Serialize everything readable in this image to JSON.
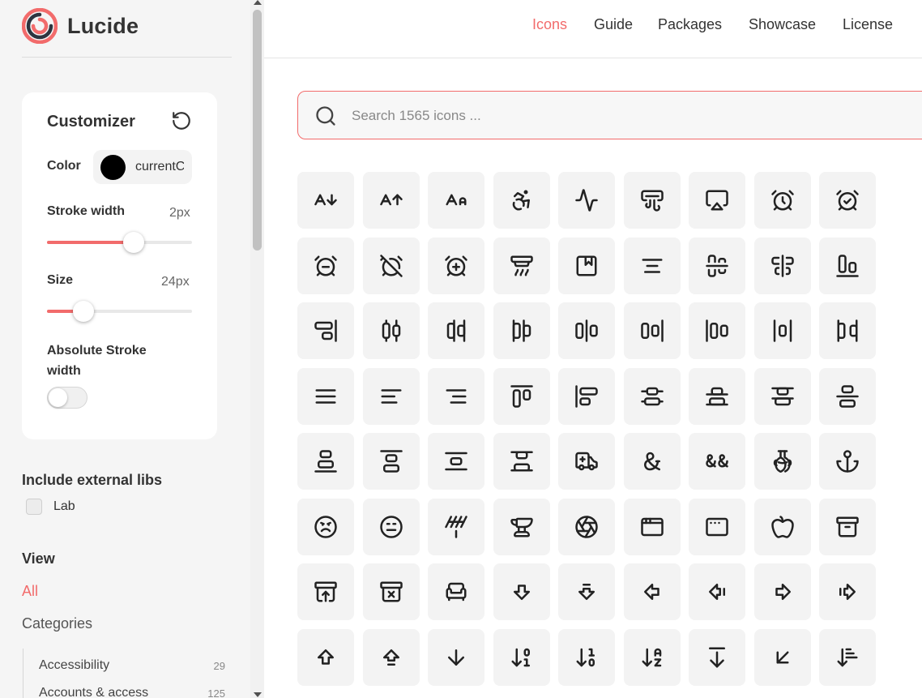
{
  "brand": {
    "name": "Lucide",
    "accent": "#f26b6b"
  },
  "nav": [
    {
      "label": "Icons",
      "active": true
    },
    {
      "label": "Guide",
      "active": false
    },
    {
      "label": "Packages",
      "active": false
    },
    {
      "label": "Showcase",
      "active": false
    },
    {
      "label": "License",
      "active": false
    }
  ],
  "customizer": {
    "title": "Customizer",
    "color_label": "Color",
    "color_value": "currentColor",
    "color_swatch": "#000000",
    "stroke_width_label": "Stroke width",
    "stroke_width_value": "2px",
    "stroke_width_fraction": 0.6,
    "size_label": "Size",
    "size_value": "24px",
    "size_fraction": 0.25,
    "absolute_stroke_label": "Absolute Stroke width",
    "absolute_stroke_on": false
  },
  "external_libs": {
    "title": "Include external libs",
    "items": [
      {
        "label": "Lab",
        "checked": false
      }
    ]
  },
  "view": {
    "title": "View",
    "all_label": "All",
    "categories_label": "Categories",
    "categories": [
      {
        "label": "Accessibility",
        "count": "29"
      },
      {
        "label": "Accounts & access",
        "count": "125"
      }
    ]
  },
  "search": {
    "placeholder": "Search 1565 icons ..."
  },
  "icons": [
    "a-arrow-down-icon",
    "a-arrow-up-icon",
    "a-large-small-icon",
    "accessibility-icon",
    "activity-icon",
    "air-vent-icon",
    "airplay-icon",
    "alarm-clock-icon",
    "alarm-clock-check-icon",
    "alarm-clock-minus-icon",
    "alarm-clock-off-icon",
    "alarm-clock-plus-icon",
    "alarm-smoke-icon",
    "album-icon",
    "align-center-icon",
    "align-center-horizontal-icon",
    "align-center-vertical-icon",
    "align-end-horizontal-icon",
    "align-end-vertical-icon",
    "align-horizontal-distribute-center-icon",
    "align-horizontal-distribute-end-icon",
    "align-horizontal-distribute-start-icon",
    "align-horizontal-justify-center-icon",
    "align-horizontal-justify-end-icon",
    "align-horizontal-justify-start-icon",
    "align-horizontal-space-around-icon",
    "align-horizontal-space-between-icon",
    "align-justify-icon",
    "align-left-icon",
    "align-right-icon",
    "align-start-horizontal-icon",
    "align-start-vertical-icon",
    "align-vertical-distribute-center-icon",
    "align-vertical-distribute-end-icon",
    "align-vertical-distribute-start-icon",
    "align-vertical-justify-center-icon",
    "align-vertical-justify-end-icon",
    "align-vertical-justify-start-icon",
    "align-vertical-space-around-icon",
    "align-vertical-space-between-icon",
    "ambulance-icon",
    "ampersand-icon",
    "ampersands-icon",
    "amphora-icon",
    "anchor-icon",
    "angry-icon",
    "annoyed-icon",
    "antenna-icon",
    "anvil-icon",
    "aperture-icon",
    "app-window-icon",
    "app-window-mac-icon",
    "apple-icon",
    "archive-icon",
    "archive-restore-icon",
    "archive-x-icon",
    "armchair-icon",
    "arrow-big-down-icon",
    "arrow-big-down-dash-icon",
    "arrow-big-left-icon",
    "arrow-big-left-dash-icon",
    "arrow-big-right-icon",
    "arrow-big-right-dash-icon",
    "arrow-big-up-icon",
    "arrow-big-up-dash-icon",
    "arrow-down-icon",
    "arrow-down-0-1-icon",
    "arrow-down-1-0-icon",
    "arrow-down-a-z-icon",
    "arrow-down-from-line-icon",
    "arrow-down-left-icon",
    "arrow-down-narrow-wide-icon"
  ]
}
